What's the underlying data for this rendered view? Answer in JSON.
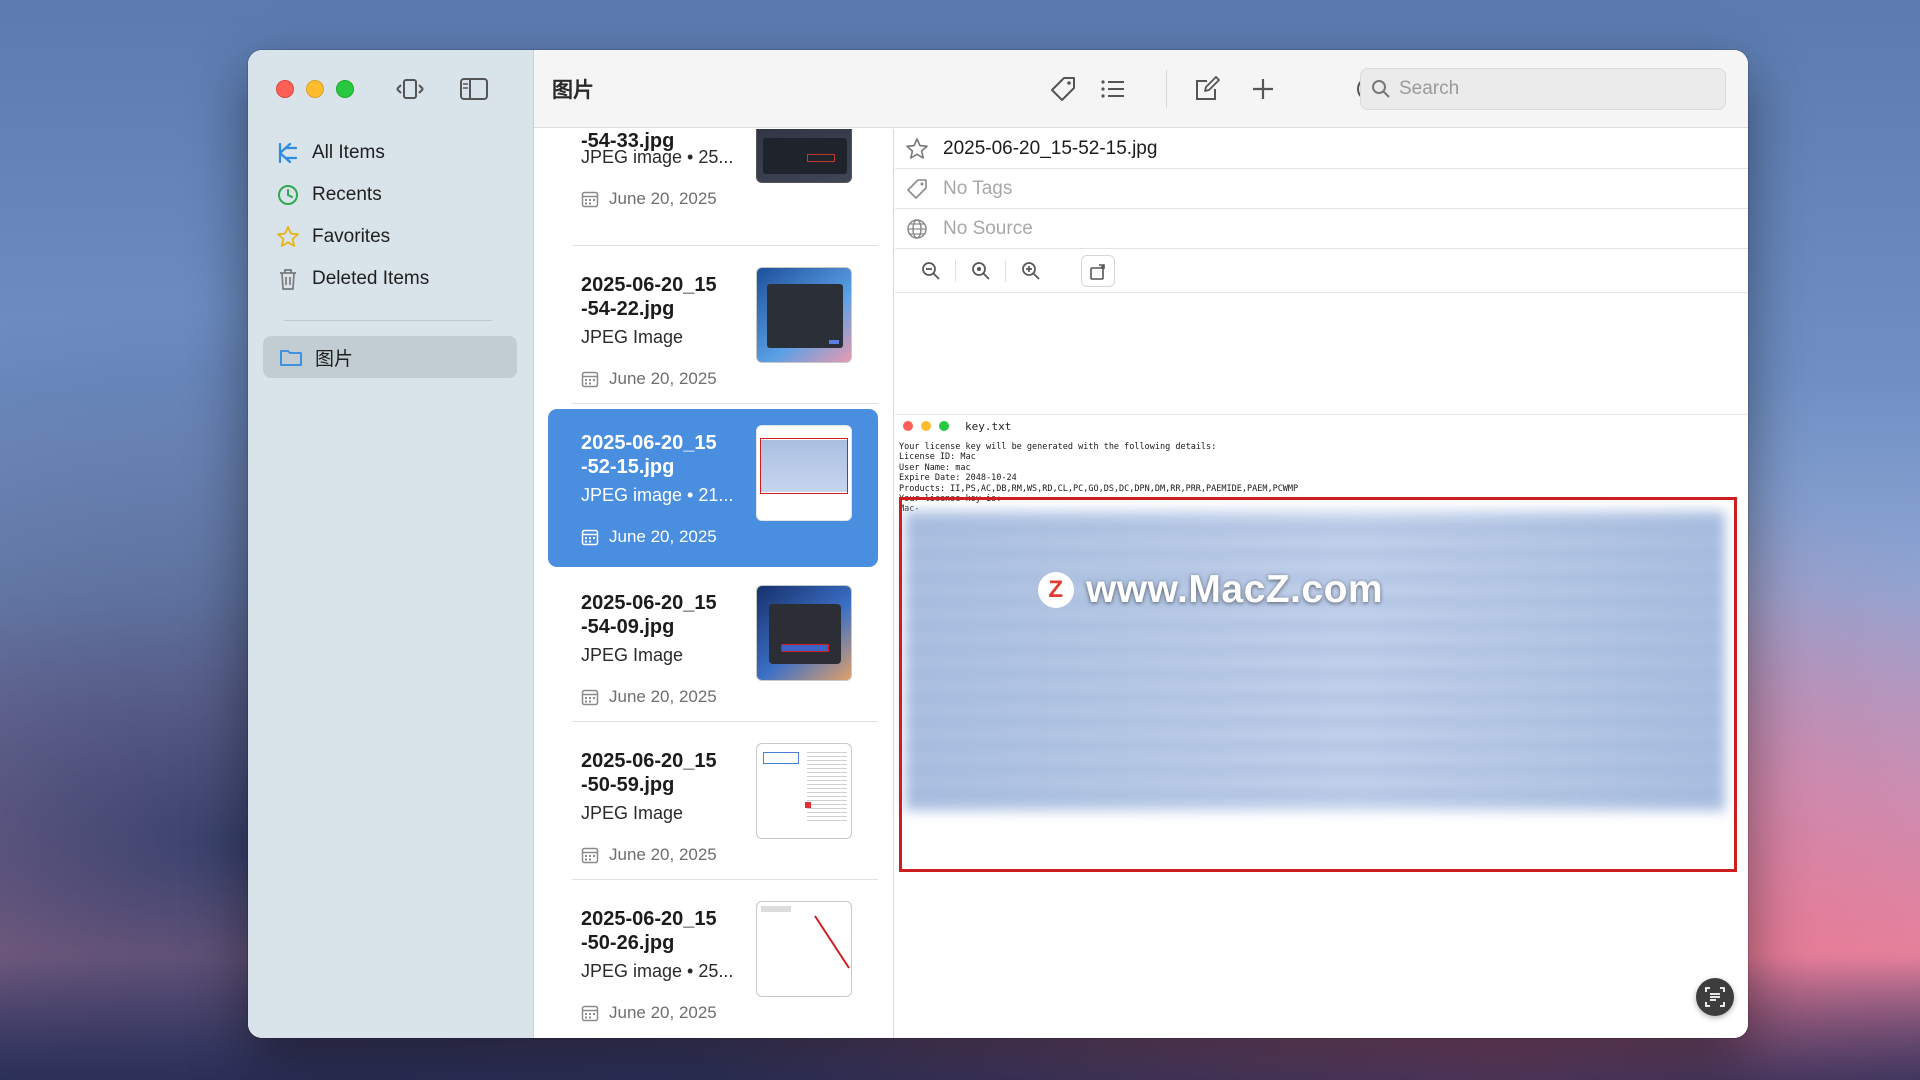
{
  "app": {
    "folder_title": "图片"
  },
  "sidebar": {
    "items": [
      {
        "label": "All Items",
        "icon": "all-items-icon",
        "color": "#2d8be0"
      },
      {
        "label": "Recents",
        "icon": "clock-icon",
        "color": "#2fa84f"
      },
      {
        "label": "Favorites",
        "icon": "star-icon",
        "color": "#e8b417"
      },
      {
        "label": "Deleted Items",
        "icon": "trash-icon",
        "color": "#7a7a7a"
      }
    ],
    "folder": {
      "label": "图片",
      "icon": "folder-icon"
    }
  },
  "toolbar": {
    "search_placeholder": "Search",
    "buttons": [
      "tag-icon",
      "list-icon",
      "compose-icon",
      "add-icon",
      "circle-icon",
      "chevron-down-icon",
      "share-icon",
      "collaborate-icon"
    ]
  },
  "list": {
    "items": [
      {
        "name": "-54-33.jpg",
        "type": "JPEG image • 25...",
        "date": "June 20, 2025",
        "selected": false
      },
      {
        "name": "2025-06-20_15-54-22.jpg",
        "name_line1": "2025-06-20_15",
        "name_line2": "-54-22.jpg",
        "type": "JPEG Image",
        "date": "June 20, 2025",
        "selected": false
      },
      {
        "name_line1": "2025-06-20_15",
        "name_line2": "-52-15.jpg",
        "type": "JPEG image • 21...",
        "date": "June 20, 2025",
        "selected": true
      },
      {
        "name_line1": "2025-06-20_15",
        "name_line2": "-54-09.jpg",
        "type": "JPEG Image",
        "date": "June 20, 2025",
        "selected": false
      },
      {
        "name_line1": "2025-06-20_15",
        "name_line2": "-50-59.jpg",
        "type": "JPEG Image",
        "date": "June 20, 2025",
        "selected": false
      },
      {
        "name_line1": "2025-06-20_15",
        "name_line2": "-50-26.jpg",
        "type": "JPEG image • 25...",
        "date": "June 20, 2025",
        "selected": false
      }
    ]
  },
  "detail": {
    "filename": "2025-06-20_15-52-15.jpg",
    "tags": "No Tags",
    "source": "No Source",
    "preview": {
      "window_title": "key.txt",
      "lines": [
        "Your license key will be generated with the following details:",
        "License ID: Mac",
        "User Name: mac",
        "Expire Date: 2048-10-24",
        "Products: II,PS,AC,DB,RM,WS,RD,CL,PC,GO,DS,DC,DPN,DM,RR,PRR,PAEMIDE,PAEM,PCWMP",
        "Your license key is:",
        "Mac-"
      ]
    }
  },
  "watermark": "www.MacZ.com",
  "colors": {
    "accent": "#4a8ee0",
    "highlight_frame": "#cc1e1e"
  }
}
